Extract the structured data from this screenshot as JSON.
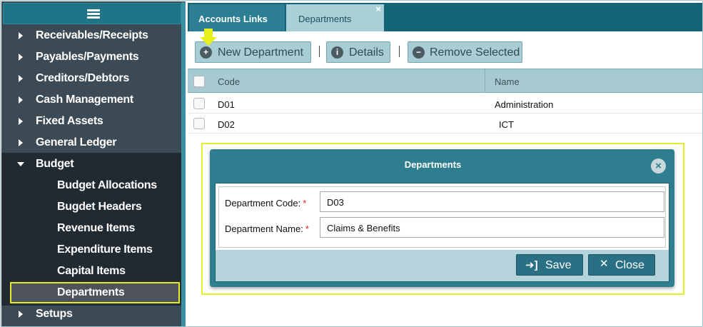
{
  "sidebar": {
    "items": [
      {
        "label": "Receivables/Receipts"
      },
      {
        "label": "Payables/Payments"
      },
      {
        "label": "Creditors/Debtors"
      },
      {
        "label": "Cash Management"
      },
      {
        "label": "Fixed Assets"
      },
      {
        "label": "General Ledger"
      },
      {
        "label": "Budget"
      },
      {
        "label": "Setups"
      }
    ],
    "budget_children": [
      {
        "label": "Budget Allocations"
      },
      {
        "label": "Bugdet Headers"
      },
      {
        "label": "Revenue Items"
      },
      {
        "label": "Expenditure Items"
      },
      {
        "label": "Capital Items"
      },
      {
        "label": "Departments"
      }
    ],
    "active_item": "Departments"
  },
  "tabs": [
    {
      "label": "Accounts Links"
    },
    {
      "label": "Departments",
      "close": "×"
    }
  ],
  "toolbar": {
    "new_label": "New Department",
    "details_label": "Details",
    "remove_label": "Remove Selected"
  },
  "grid": {
    "headers": {
      "code": "Code",
      "name": "Name"
    },
    "rows": [
      {
        "code": "D01",
        "name": "Administration"
      },
      {
        "code": "D02",
        "name": "ICT"
      }
    ]
  },
  "modal": {
    "title": "Departments",
    "code_label": "Department Code:",
    "code_value": "D03",
    "name_label": "Department Name:",
    "name_value": "Claims & Benefits",
    "required_mark": "*",
    "save_label": "Save",
    "close_label": "Close"
  },
  "colors": {
    "highlight": "#e4ee2a",
    "tab_bar": "#136576",
    "sidebar_bg": "#3b4a55",
    "accent": "#2e7e90"
  }
}
